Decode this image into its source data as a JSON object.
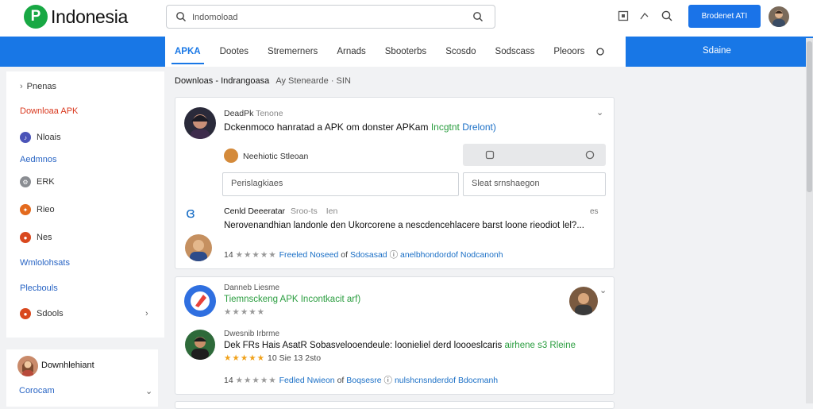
{
  "header": {
    "logo_mark": "P",
    "logo_text": "Indonesia",
    "search_value": "Indomoload",
    "cta_label": "Brodenet ATI"
  },
  "nav": {
    "tabs": [
      "APKA",
      "Dootes",
      "Stremerners",
      "Arnads",
      "Sbooterbs",
      "Scosdo",
      "Sodscass",
      "Pleoors"
    ],
    "right_label": "Sdaine"
  },
  "sidebar": {
    "items": [
      {
        "label": "Pnenas",
        "icon": "chevron-right"
      },
      {
        "label": "Downloaa APK",
        "icon": ""
      },
      {
        "label": "Nloais",
        "icon": "dot"
      },
      {
        "label": "Aedmnos",
        "icon": ""
      },
      {
        "label": "ERK",
        "icon": "dot"
      },
      {
        "label": "Rieo",
        "icon": "dot"
      },
      {
        "label": "Nes",
        "icon": "dot"
      },
      {
        "label": "Wmlolohsats",
        "icon": ""
      },
      {
        "label": "Plecbouls",
        "icon": ""
      },
      {
        "label": "Sdools",
        "icon": "dot"
      }
    ],
    "bottom_title": "Downhlehiant",
    "bottom_link": "Corocam"
  },
  "main": {
    "breadcrumb": "Downloas - Indrangoasa",
    "breadcrumb_tail": "Ay Stenearde · SIN",
    "post1": {
      "author": "DeadPk",
      "author_tag": "Tenone",
      "title_plain": "Dckenmoco hanratad a APK om donster APKam",
      "title_green": "Incgtnt",
      "title_blue": "Drelont)",
      "sub_author": "Neehiotic Stleoan",
      "input_left": "Perislagkiaes",
      "input_right": "Sleat srnshaegon",
      "reply_author": "Cenld Deeeratar",
      "reply_tag": "Sroo-ts",
      "reply_time": "Ien",
      "reply_ago": "es",
      "reply_text": "Nerovenandhian landonle den Ukorcorene a nescdencehlacere barst loone rieodiot lel?...",
      "rating": "14",
      "link1": "Freeled Noseed",
      "sep": "of",
      "link2": "Sdosasad",
      "link3": "anelbhondordof Nodcanonh"
    },
    "post2": {
      "author": "Danneb Liesme",
      "title_green": "Tiemnsckeng APK Incontkacit arf)",
      "reply_author": "Dwesnib Irbrme",
      "reply_text": "Dek FRs Hais AsatR Sobasvelooendeule:  loonieliel derd loooeslcaris",
      "reply_green": "airhene s3 Rleine",
      "rating_line": "10  Sie 13 2sto",
      "rating2": "14",
      "link1": "Fedled Nwieon",
      "sep": "of",
      "link2": "Boqsesre",
      "link3": "nulshcnsnderdof Bdocmanh"
    }
  }
}
